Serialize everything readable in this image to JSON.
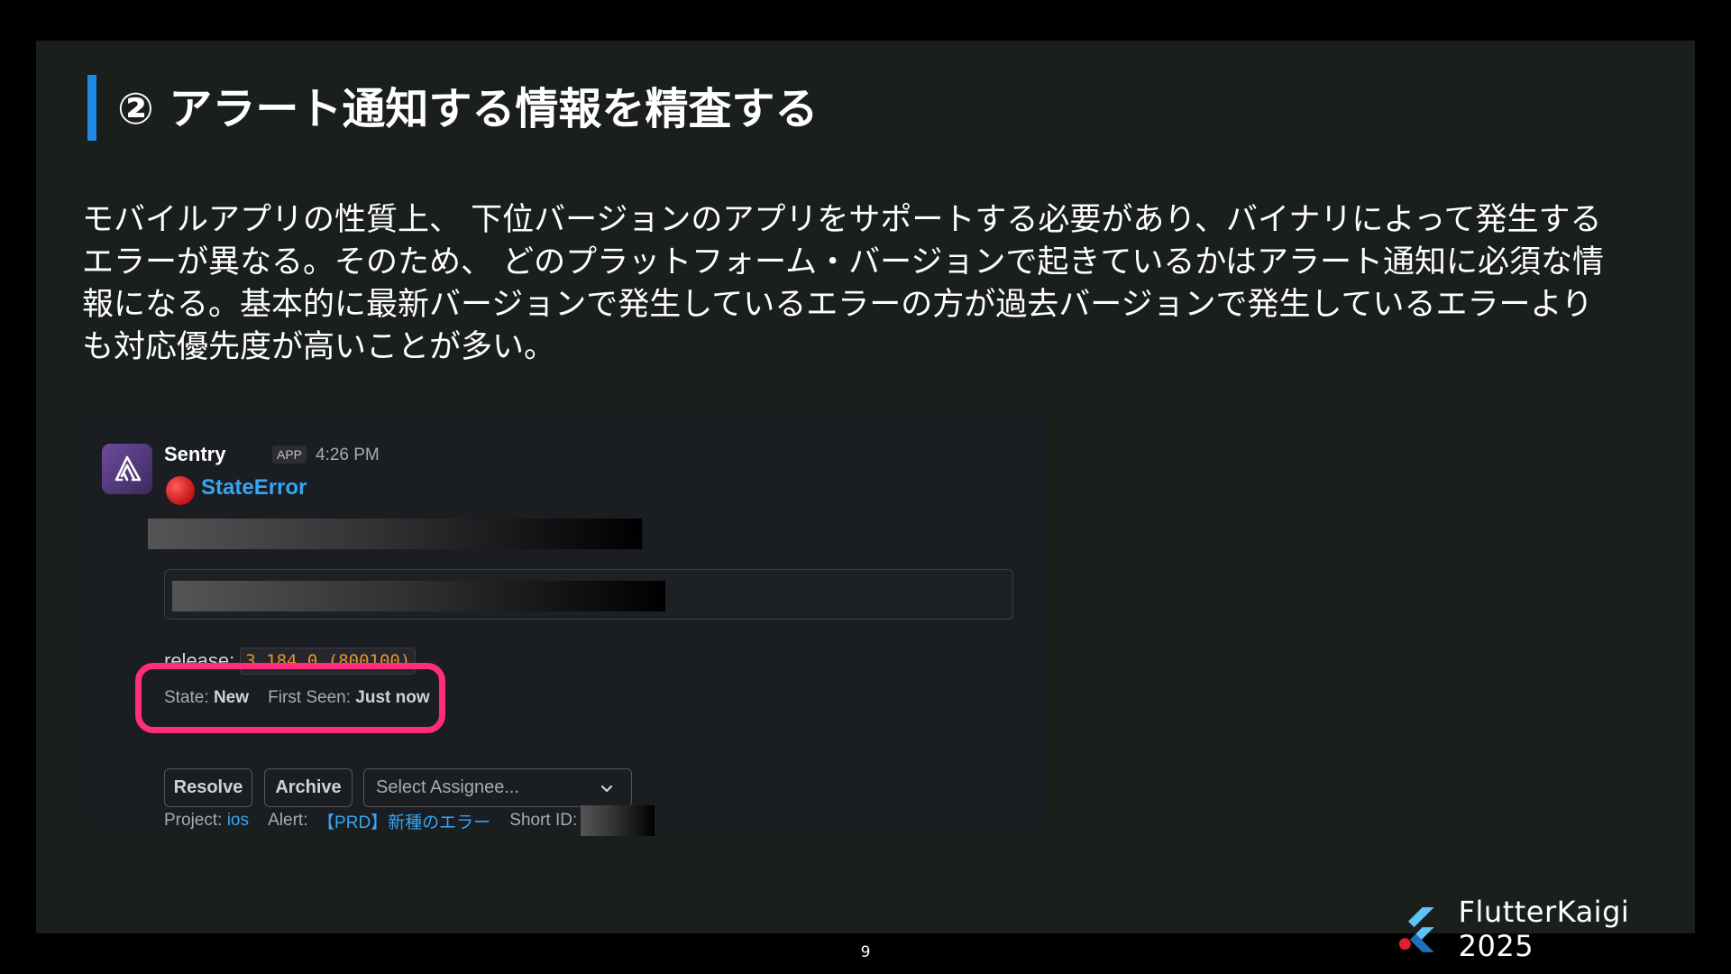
{
  "slide": {
    "title": "② アラート通知する情報を精査する",
    "body_lines": [
      "モバイルアプリの性質上、 下位バージョンのアプリをサポートする必要があり、バイナリによって発生する",
      "エラーが異なる。そのため、 どのプラットフォーム・バージョンで起きているかはアラート通知に必須な情",
      "報になる。基本的に最新バージョンで発生しているエラーの方が過去バージョンで発生しているエラーより",
      "も対応優先度が高いことが多い。"
    ],
    "accent_color": "#1e88e5",
    "page_number": "9"
  },
  "slack_message": {
    "sender": "Sentry",
    "badge": "APP",
    "time": "4:26 PM",
    "error_title": "StateError",
    "release_label": "release:",
    "release_value": "3.184.0 (800100)",
    "state_label": "State:",
    "state_value": "New",
    "first_seen_label": "First Seen:",
    "first_seen_value": "Just now",
    "buttons": {
      "resolve": "Resolve",
      "archive": "Archive"
    },
    "assignee_placeholder": "Select Assignee...",
    "project_label": "Project:",
    "project_value": "ios",
    "alert_label": "Alert:",
    "alert_value": "【PRD】新種のエラー",
    "short_id_label": "Short ID:",
    "highlight_color": "#ff2d7a",
    "link_color": "#36a6f3"
  },
  "branding": {
    "text": "FlutterKaigi 2025"
  }
}
